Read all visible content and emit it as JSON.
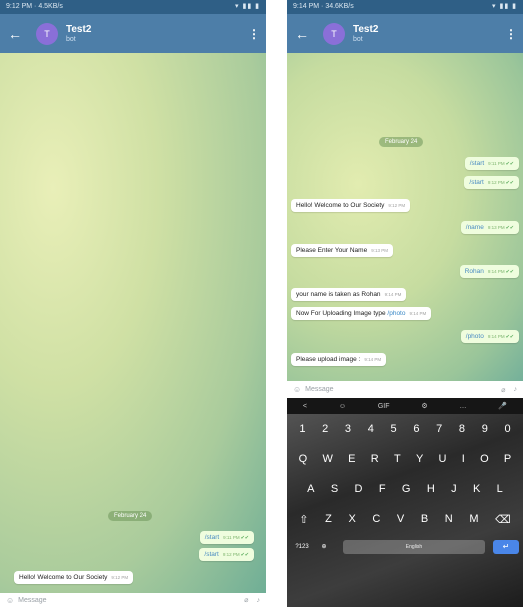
{
  "left": {
    "status_time": "9:12 PM",
    "status_speed": "4.5KB/s",
    "header": {
      "avatar_letter": "T",
      "name": "Test2",
      "subtitle": "bot"
    },
    "date_pill": "February 24",
    "messages": [
      {
        "text": "/start",
        "time": "9:11 PM"
      },
      {
        "text": "/start",
        "time": "9:12 PM"
      },
      {
        "text": "Hello! Welcome to Our Society",
        "time": "9:12 PM"
      }
    ],
    "input_placeholder": "Message"
  },
  "right": {
    "status_time": "9:14 PM",
    "status_speed": "34.6KB/s",
    "header": {
      "avatar_letter": "T",
      "name": "Test2",
      "subtitle": "bot"
    },
    "date_pill": "February 24",
    "messages": [
      {
        "text": "/start",
        "time": "9:11 PM"
      },
      {
        "text": "/start",
        "time": "9:12 PM"
      },
      {
        "text": "Hello! Welcome to Our Society",
        "time": "9:12 PM"
      },
      {
        "text": "/name",
        "time": "9:13 PM"
      },
      {
        "text": "Please Enter Your Name",
        "time": "9:13 PM"
      },
      {
        "text": "Rohan",
        "time": "9:14 PM"
      },
      {
        "text": "your name is taken as Rohan",
        "time": "9:14 PM"
      },
      {
        "prefix": "Now For Uploading Image type ",
        "command": "/photo",
        "time": "9:14 PM"
      },
      {
        "text": "/photo",
        "time": "9:14 PM"
      },
      {
        "text": "Please upload image :",
        "time": "9:14 PM"
      }
    ],
    "input_placeholder": "Message",
    "keyboard": {
      "toolbar": [
        "<",
        "☺",
        "GIF",
        "⚙",
        "…",
        "🎤"
      ],
      "numbers": [
        "1",
        "2",
        "3",
        "4",
        "5",
        "6",
        "7",
        "8",
        "9",
        "0"
      ],
      "row1": [
        "Q",
        "W",
        "E",
        "R",
        "T",
        "Y",
        "U",
        "I",
        "O",
        "P"
      ],
      "row2": [
        "A",
        "S",
        "D",
        "F",
        "G",
        "H",
        "J",
        "K",
        "L"
      ],
      "row3": [
        "⇧",
        "Z",
        "X",
        "C",
        "V",
        "B",
        "N",
        "M",
        "⌫"
      ],
      "symbols_key": "?123",
      "space_label": "English",
      "enter_symbol": "↵"
    }
  }
}
